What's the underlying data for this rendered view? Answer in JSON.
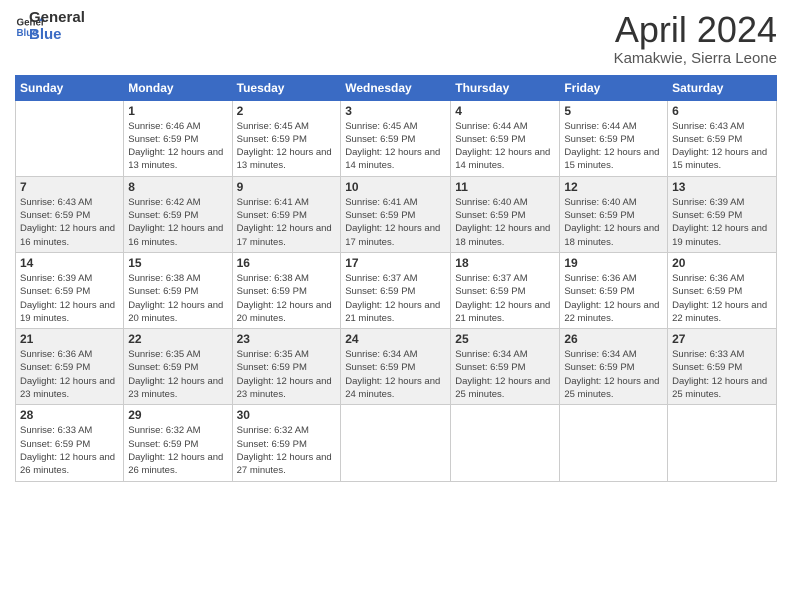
{
  "logo": {
    "line1": "General",
    "line2": "Blue"
  },
  "title": "April 2024",
  "location": "Kamakwie, Sierra Leone",
  "days_of_week": [
    "Sunday",
    "Monday",
    "Tuesday",
    "Wednesday",
    "Thursday",
    "Friday",
    "Saturday"
  ],
  "weeks": [
    [
      {
        "num": "",
        "info": ""
      },
      {
        "num": "1",
        "sunrise": "Sunrise: 6:46 AM",
        "sunset": "Sunset: 6:59 PM",
        "daylight": "Daylight: 12 hours and 13 minutes."
      },
      {
        "num": "2",
        "sunrise": "Sunrise: 6:45 AM",
        "sunset": "Sunset: 6:59 PM",
        "daylight": "Daylight: 12 hours and 13 minutes."
      },
      {
        "num": "3",
        "sunrise": "Sunrise: 6:45 AM",
        "sunset": "Sunset: 6:59 PM",
        "daylight": "Daylight: 12 hours and 14 minutes."
      },
      {
        "num": "4",
        "sunrise": "Sunrise: 6:44 AM",
        "sunset": "Sunset: 6:59 PM",
        "daylight": "Daylight: 12 hours and 14 minutes."
      },
      {
        "num": "5",
        "sunrise": "Sunrise: 6:44 AM",
        "sunset": "Sunset: 6:59 PM",
        "daylight": "Daylight: 12 hours and 15 minutes."
      },
      {
        "num": "6",
        "sunrise": "Sunrise: 6:43 AM",
        "sunset": "Sunset: 6:59 PM",
        "daylight": "Daylight: 12 hours and 15 minutes."
      }
    ],
    [
      {
        "num": "7",
        "sunrise": "Sunrise: 6:43 AM",
        "sunset": "Sunset: 6:59 PM",
        "daylight": "Daylight: 12 hours and 16 minutes."
      },
      {
        "num": "8",
        "sunrise": "Sunrise: 6:42 AM",
        "sunset": "Sunset: 6:59 PM",
        "daylight": "Daylight: 12 hours and 16 minutes."
      },
      {
        "num": "9",
        "sunrise": "Sunrise: 6:41 AM",
        "sunset": "Sunset: 6:59 PM",
        "daylight": "Daylight: 12 hours and 17 minutes."
      },
      {
        "num": "10",
        "sunrise": "Sunrise: 6:41 AM",
        "sunset": "Sunset: 6:59 PM",
        "daylight": "Daylight: 12 hours and 17 minutes."
      },
      {
        "num": "11",
        "sunrise": "Sunrise: 6:40 AM",
        "sunset": "Sunset: 6:59 PM",
        "daylight": "Daylight: 12 hours and 18 minutes."
      },
      {
        "num": "12",
        "sunrise": "Sunrise: 6:40 AM",
        "sunset": "Sunset: 6:59 PM",
        "daylight": "Daylight: 12 hours and 18 minutes."
      },
      {
        "num": "13",
        "sunrise": "Sunrise: 6:39 AM",
        "sunset": "Sunset: 6:59 PM",
        "daylight": "Daylight: 12 hours and 19 minutes."
      }
    ],
    [
      {
        "num": "14",
        "sunrise": "Sunrise: 6:39 AM",
        "sunset": "Sunset: 6:59 PM",
        "daylight": "Daylight: 12 hours and 19 minutes."
      },
      {
        "num": "15",
        "sunrise": "Sunrise: 6:38 AM",
        "sunset": "Sunset: 6:59 PM",
        "daylight": "Daylight: 12 hours and 20 minutes."
      },
      {
        "num": "16",
        "sunrise": "Sunrise: 6:38 AM",
        "sunset": "Sunset: 6:59 PM",
        "daylight": "Daylight: 12 hours and 20 minutes."
      },
      {
        "num": "17",
        "sunrise": "Sunrise: 6:37 AM",
        "sunset": "Sunset: 6:59 PM",
        "daylight": "Daylight: 12 hours and 21 minutes."
      },
      {
        "num": "18",
        "sunrise": "Sunrise: 6:37 AM",
        "sunset": "Sunset: 6:59 PM",
        "daylight": "Daylight: 12 hours and 21 minutes."
      },
      {
        "num": "19",
        "sunrise": "Sunrise: 6:36 AM",
        "sunset": "Sunset: 6:59 PM",
        "daylight": "Daylight: 12 hours and 22 minutes."
      },
      {
        "num": "20",
        "sunrise": "Sunrise: 6:36 AM",
        "sunset": "Sunset: 6:59 PM",
        "daylight": "Daylight: 12 hours and 22 minutes."
      }
    ],
    [
      {
        "num": "21",
        "sunrise": "Sunrise: 6:36 AM",
        "sunset": "Sunset: 6:59 PM",
        "daylight": "Daylight: 12 hours and 23 minutes."
      },
      {
        "num": "22",
        "sunrise": "Sunrise: 6:35 AM",
        "sunset": "Sunset: 6:59 PM",
        "daylight": "Daylight: 12 hours and 23 minutes."
      },
      {
        "num": "23",
        "sunrise": "Sunrise: 6:35 AM",
        "sunset": "Sunset: 6:59 PM",
        "daylight": "Daylight: 12 hours and 23 minutes."
      },
      {
        "num": "24",
        "sunrise": "Sunrise: 6:34 AM",
        "sunset": "Sunset: 6:59 PM",
        "daylight": "Daylight: 12 hours and 24 minutes."
      },
      {
        "num": "25",
        "sunrise": "Sunrise: 6:34 AM",
        "sunset": "Sunset: 6:59 PM",
        "daylight": "Daylight: 12 hours and 25 minutes."
      },
      {
        "num": "26",
        "sunrise": "Sunrise: 6:34 AM",
        "sunset": "Sunset: 6:59 PM",
        "daylight": "Daylight: 12 hours and 25 minutes."
      },
      {
        "num": "27",
        "sunrise": "Sunrise: 6:33 AM",
        "sunset": "Sunset: 6:59 PM",
        "daylight": "Daylight: 12 hours and 25 minutes."
      }
    ],
    [
      {
        "num": "28",
        "sunrise": "Sunrise: 6:33 AM",
        "sunset": "Sunset: 6:59 PM",
        "daylight": "Daylight: 12 hours and 26 minutes."
      },
      {
        "num": "29",
        "sunrise": "Sunrise: 6:32 AM",
        "sunset": "Sunset: 6:59 PM",
        "daylight": "Daylight: 12 hours and 26 minutes."
      },
      {
        "num": "30",
        "sunrise": "Sunrise: 6:32 AM",
        "sunset": "Sunset: 6:59 PM",
        "daylight": "Daylight: 12 hours and 27 minutes."
      },
      {
        "num": "",
        "info": ""
      },
      {
        "num": "",
        "info": ""
      },
      {
        "num": "",
        "info": ""
      },
      {
        "num": "",
        "info": ""
      }
    ]
  ]
}
